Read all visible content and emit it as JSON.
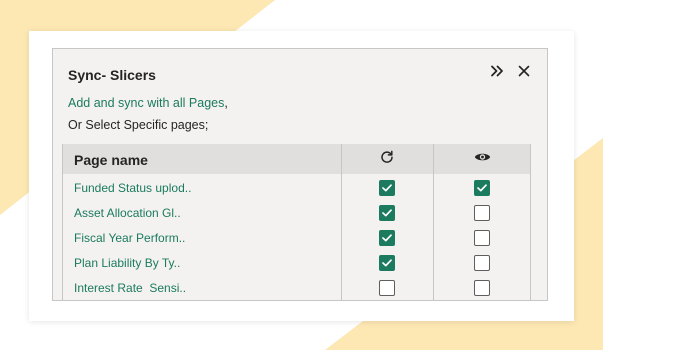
{
  "dialog": {
    "title": "Sync- Slicers",
    "sync_all_link": "Add and sync with all Pages",
    "sync_all_suffix": ",",
    "select_specific": "Or Select Specific pages;"
  },
  "table": {
    "column_page_name": "Page name",
    "column_sync_icon": "refresh-icon",
    "column_visible_icon": "eye-icon",
    "rows": [
      {
        "name": "Funded Status uplod..",
        "sync": true,
        "visible": true
      },
      {
        "name": "Asset Allocation Gl..",
        "sync": true,
        "visible": false
      },
      {
        "name": "Fiscal Year Perform..",
        "sync": true,
        "visible": false
      },
      {
        "name": "Plan Liability By Ty..",
        "sync": true,
        "visible": false
      },
      {
        "name": "Interest Rate  Sensi..",
        "sync": false,
        "visible": false
      }
    ]
  },
  "colors": {
    "accent": "#1c7a5e",
    "background_shape": "#fde7b3",
    "dialog_background": "#f3f2f1",
    "header_background": "#e1dfdd"
  }
}
